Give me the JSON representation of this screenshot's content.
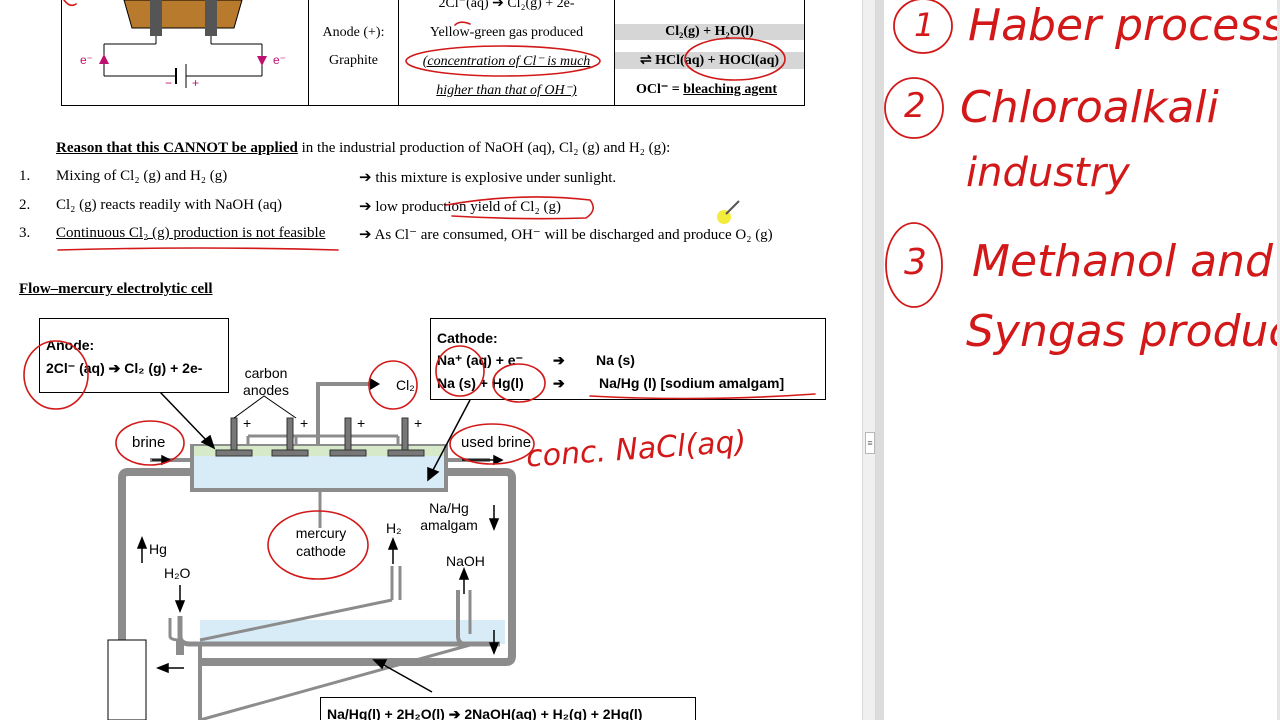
{
  "table": {
    "top_reaction": "2Cl⁻(aq) ➔ Cl₂(g) + 2e-",
    "circuit_e_left": "e⁻",
    "circuit_e_right": "e⁻",
    "circuit_minus": "−",
    "circuit_plus": "+",
    "anode_label": "Anode (+):",
    "anode_material": "Graphite",
    "yellow_green": "Yellow-green gas produced",
    "concentration": "(concentration of Cl⁻ is much",
    "higher_than": "higher than that of OH⁻)",
    "eq1": "Cl₂(g) + H₂O(l)",
    "eq2": "⇌ HCl(aq) + HOCl(aq)",
    "ocl_prefix": "OCl⁻ =",
    "bleaching": "bleaching agent"
  },
  "reason": {
    "heading": "Reason that this CANNOT be applied",
    "heading_rest": " in the industrial production of NaOH (aq), Cl₂ (g) and H₂ (g):",
    "items": [
      {
        "num": "1.",
        "cause": "Mixing of Cl₂ (g) and H₂ (g)",
        "effect": "➔ this mixture is explosive under sunlight."
      },
      {
        "num": "2.",
        "cause": "Cl₂ (g) reacts readily with NaOH (aq)",
        "effect": "➔ low production yield of Cl₂ (g)"
      },
      {
        "num": "3.",
        "cause": "Continuous Cl₂ (g) production is not feasible",
        "effect": "➔ As Cl⁻ are consumed, OH⁻ will be discharged and produce O₂ (g)"
      }
    ]
  },
  "section_title": "Flow–mercury electrolytic cell",
  "diagram": {
    "anode_box_title": "Anode:",
    "anode_box_eq": "2Cl⁻ (aq) ➔ Cl₂ (g) + 2e-",
    "cathode_box_title": "Cathode:",
    "cathode_eq1_left": "Na⁺ (aq) + e⁻",
    "cathode_arrow": "➔",
    "cathode_eq1_right": "Na (s)",
    "cathode_eq2_left": "Na (s) + Hg(l)",
    "cathode_eq2_right": "Na/Hg (l)  [sodium amalgam]",
    "carbon_anodes": [
      "carbon",
      "anodes"
    ],
    "cl2": "Cl₂",
    "brine": "brine",
    "used_brine": "used brine",
    "nahg_amalgam": [
      "Na/Hg",
      "amalgam"
    ],
    "mercury_cathode": [
      "mercury",
      "cathode"
    ],
    "h2": "H₂",
    "hg": "Hg",
    "h2o": "H₂O",
    "naoh": "NaOH",
    "plus": "+",
    "bottom_eq": "Na/Hg(l) + 2H₂O(l) ➔ 2NaOH(aq) + H₂(g) + 2Hg(l)"
  },
  "annotations": {
    "conc_nacl": "conc. NaCl(aq)"
  },
  "notes": {
    "items": [
      {
        "num": "1",
        "lines": [
          "Haber process"
        ]
      },
      {
        "num": "2",
        "lines": [
          "Chloroalkali",
          "industry"
        ]
      },
      {
        "num": "3",
        "lines": [
          "Methanol and",
          "Syngas production"
        ]
      }
    ]
  },
  "colors": {
    "ink_red": "#d21818",
    "anode_fill": "#b87a2c",
    "electrolyte_top": "#d6e9c8",
    "electrolyte_blue": "#d8ecf7",
    "cell_gray": "#8c8c8c",
    "magenta": "#c0106f"
  }
}
